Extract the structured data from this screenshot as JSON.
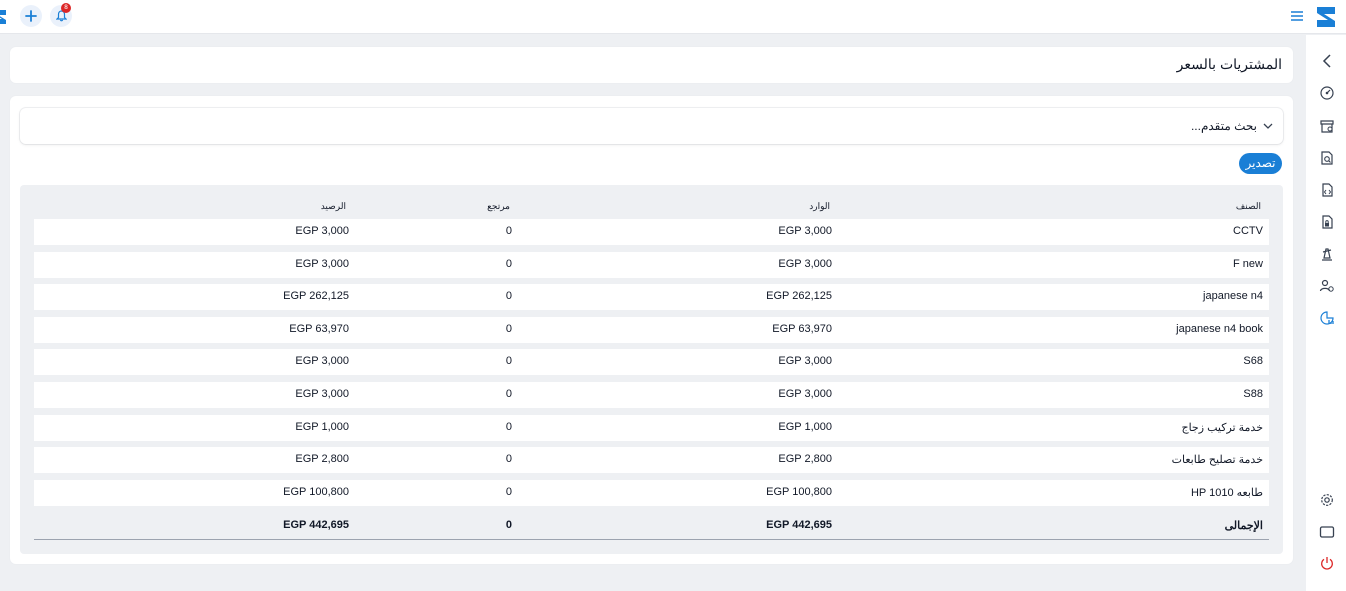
{
  "header": {
    "notification_count": "8",
    "colors": {
      "accent": "#1a7fd6",
      "badge": "#dc2626"
    }
  },
  "page": {
    "title": "المشتريات بالسعر"
  },
  "search": {
    "advanced_label": "بحث متقدم..."
  },
  "toolbar": {
    "export_label": "تصدير"
  },
  "table": {
    "headers": {
      "item": "الصنف",
      "incoming": "الوارد",
      "returned": "مرتجع",
      "balance": "الرصيد"
    },
    "rows": [
      {
        "item": "CCTV",
        "incoming": "EGP 3,000",
        "returned": "0",
        "balance": "EGP 3,000"
      },
      {
        "item": "F new",
        "incoming": "EGP 3,000",
        "returned": "0",
        "balance": "EGP 3,000"
      },
      {
        "item": "japanese n4",
        "incoming": "EGP 262,125",
        "returned": "0",
        "balance": "EGP 262,125"
      },
      {
        "item": "japanese n4 book",
        "incoming": "EGP 63,970",
        "returned": "0",
        "balance": "EGP 63,970"
      },
      {
        "item": "S68",
        "incoming": "EGP 3,000",
        "returned": "0",
        "balance": "EGP 3,000"
      },
      {
        "item": "S88",
        "incoming": "EGP 3,000",
        "returned": "0",
        "balance": "EGP 3,000"
      },
      {
        "item": "خدمة تركيب زجاج",
        "incoming": "EGP 1,000",
        "returned": "0",
        "balance": "EGP 1,000"
      },
      {
        "item": "خدمة تصليح طابعات",
        "incoming": "EGP 2,800",
        "returned": "0",
        "balance": "EGP 2,800"
      },
      {
        "item": "طابعه HP 1010",
        "incoming": "EGP 100,800",
        "returned": "0",
        "balance": "EGP 100,800"
      }
    ],
    "total": {
      "label": "الإجمالى",
      "incoming": "EGP 442,695",
      "returned": "0",
      "balance": "EGP 442,695"
    }
  },
  "sidebar": {
    "icons": [
      "collapse-chevron-icon",
      "dashboard-icon",
      "store-icon",
      "search-document-icon",
      "document-code-icon",
      "document-lock-icon",
      "scale-icon",
      "users-settings-icon",
      "reports-chart-icon",
      "settings-gear-icon",
      "window-icon",
      "power-icon"
    ]
  }
}
